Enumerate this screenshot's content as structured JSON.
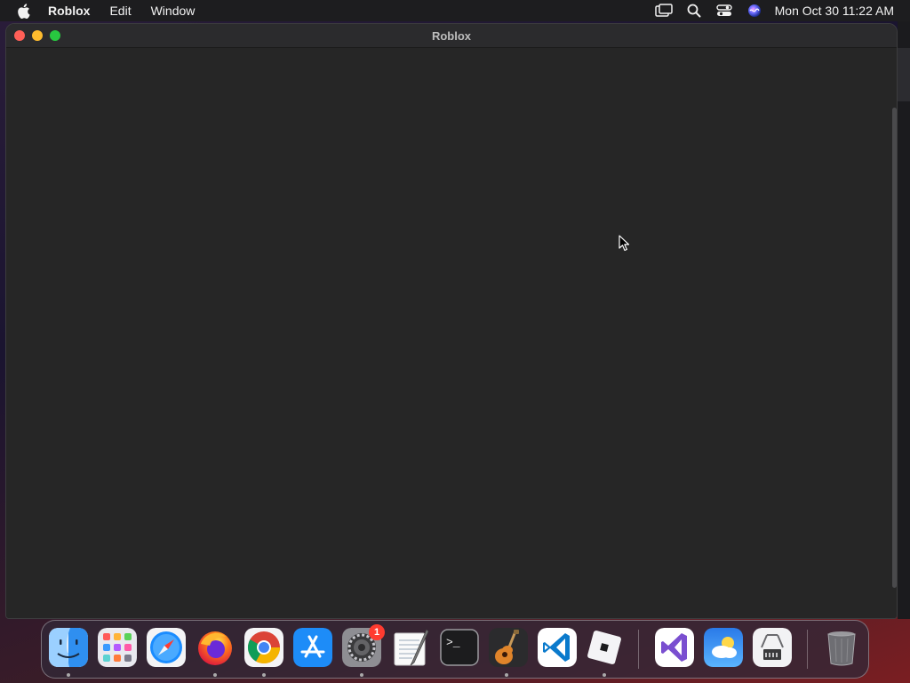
{
  "menubar": {
    "app_name": "Roblox",
    "items": [
      "Edit",
      "Window"
    ],
    "clock": "Mon Oct 30  11:22 AM"
  },
  "window": {
    "title": "Roblox"
  },
  "dock": {
    "items": [
      {
        "name": "Finder",
        "icon": "finder-icon",
        "running": true
      },
      {
        "name": "Launchpad",
        "icon": "launchpad-icon",
        "running": false
      },
      {
        "name": "Safari",
        "icon": "safari-icon",
        "running": false
      },
      {
        "name": "Firefox",
        "icon": "firefox-icon",
        "running": true
      },
      {
        "name": "Google Chrome",
        "icon": "chrome-icon",
        "running": true
      },
      {
        "name": "App Store",
        "icon": "app-store-icon",
        "running": false
      },
      {
        "name": "System Settings",
        "icon": "system-settings-icon",
        "running": true,
        "badge": "1"
      },
      {
        "name": "TextEdit",
        "icon": "textedit-icon",
        "running": false
      },
      {
        "name": "Terminal",
        "icon": "terminal-icon",
        "running": false
      },
      {
        "name": "GarageBand",
        "icon": "garageband-icon",
        "running": true
      },
      {
        "name": "Visual Studio Code",
        "icon": "vscode-icon",
        "running": false
      },
      {
        "name": "Roblox",
        "icon": "roblox-icon",
        "running": true
      },
      {
        "name": "Visual Studio",
        "icon": "visual-studio-icon",
        "running": false
      },
      {
        "name": "Weather",
        "icon": "weather-icon",
        "running": false
      },
      {
        "name": "System Information",
        "icon": "system-information-icon",
        "running": false
      },
      {
        "name": "Trash",
        "icon": "trash-icon",
        "running": false
      }
    ],
    "terminal_prompt": ">_"
  },
  "colors": {
    "menubar_bg": "#1d1d1f",
    "window_bg": "#262626",
    "close": "#ff5f57",
    "minimize": "#febc2e",
    "maximize": "#28c840",
    "badge": "#ff3b30"
  }
}
